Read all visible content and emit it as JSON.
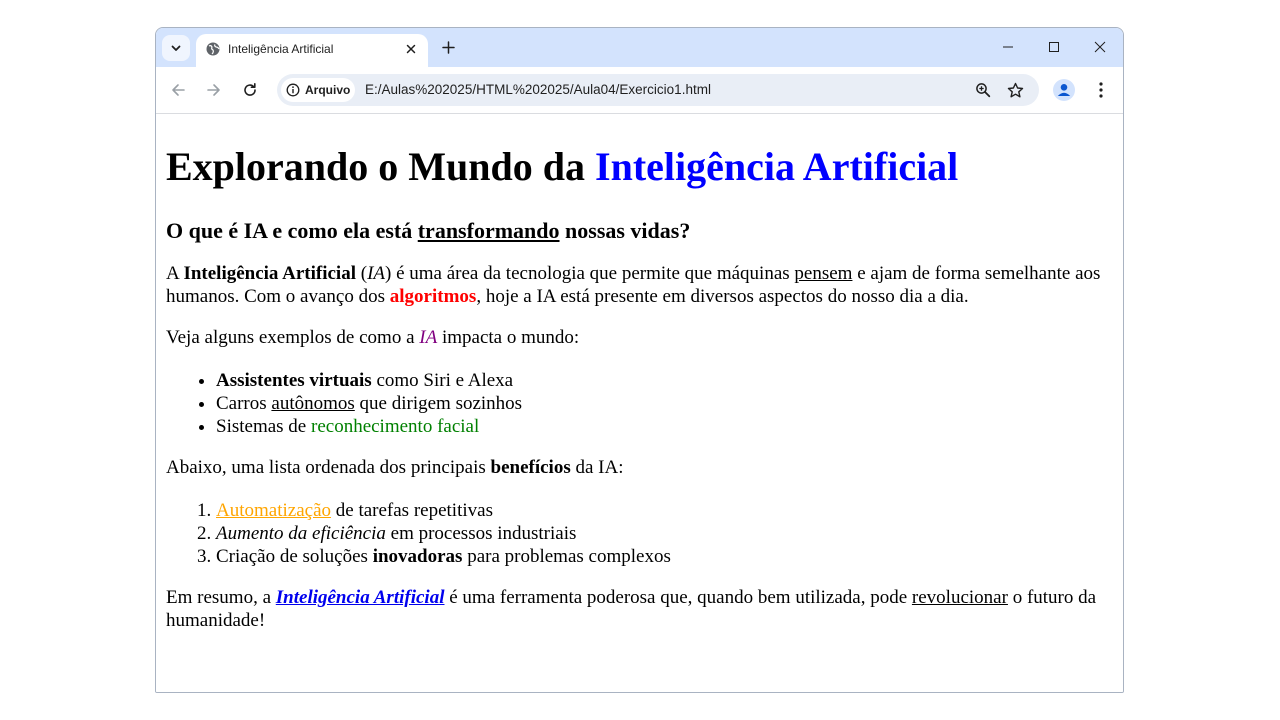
{
  "browser": {
    "tab_title": "Inteligência Artificial",
    "security_chip_label": "Arquivo",
    "url": "E:/Aulas%202025/HTML%202025/Aula04/Exercicio1.html"
  },
  "icons": {
    "tab_search": "chevron-down-icon",
    "favicon": "globe-icon",
    "tab_close": "close-icon",
    "new_tab": "plus-icon",
    "minimize": "minimize-icon",
    "maximize": "maximize-icon",
    "close_window": "close-icon",
    "back": "arrow-left-icon",
    "forward": "arrow-right-icon",
    "reload": "reload-icon",
    "info": "info-icon",
    "zoom": "zoom-icon",
    "bookmark": "star-icon",
    "profile": "person-icon",
    "menu": "kebab-menu-icon"
  },
  "page": {
    "h1": {
      "part1": "Explorando o Mundo da ",
      "part2": "Inteligência Artificial"
    },
    "h2": {
      "part1": "O que é IA e como ela está ",
      "underlined": "transformando",
      "part2": " nossas vidas?"
    },
    "p1": {
      "t1": "A ",
      "bold": "Inteligência Artificial",
      "t2": " (",
      "italic": "IA",
      "t3": ") é uma área da tecnologia que permite que máquinas ",
      "underlined": "pensem",
      "t4": " e ajam de forma semelhante aos humanos. Com o avanço dos ",
      "red_bold": "algoritmos",
      "t5": ", hoje a IA está presente em diversos aspectos do nosso dia a dia."
    },
    "p2": {
      "t1": "Veja alguns exemplos de como a ",
      "purple_italic": "IA",
      "t2": " impacta o mundo:"
    },
    "ul": [
      {
        "bold": "Assistentes virtuais",
        "rest": " como Siri e Alexa"
      },
      {
        "t1": "Carros ",
        "underlined": "autônomos",
        "t2": " que dirigem sozinhos"
      },
      {
        "t1": "Sistemas de ",
        "green": "reconhecimento facial"
      }
    ],
    "p3": {
      "t1": "Abaixo, uma lista ordenada dos principais ",
      "bold": "benefícios",
      "t2": " da IA:"
    },
    "ol": [
      {
        "orange_underlined": "Automatização",
        "rest": " de tarefas repetitivas"
      },
      {
        "italic": "Aumento da eficiência",
        "rest": " em processos industriais"
      },
      {
        "t1": "Criação de soluções ",
        "bold": "inovadoras",
        "t2": " para problemas complexos"
      }
    ],
    "p4": {
      "t1": "Em resumo, a ",
      "link": "Inteligência Artificial",
      "t2": " é uma ferramenta poderosa que, quando bem utilizada, pode ",
      "underlined": "revolucionar",
      "t3": " o futuro da humanidade!"
    }
  }
}
